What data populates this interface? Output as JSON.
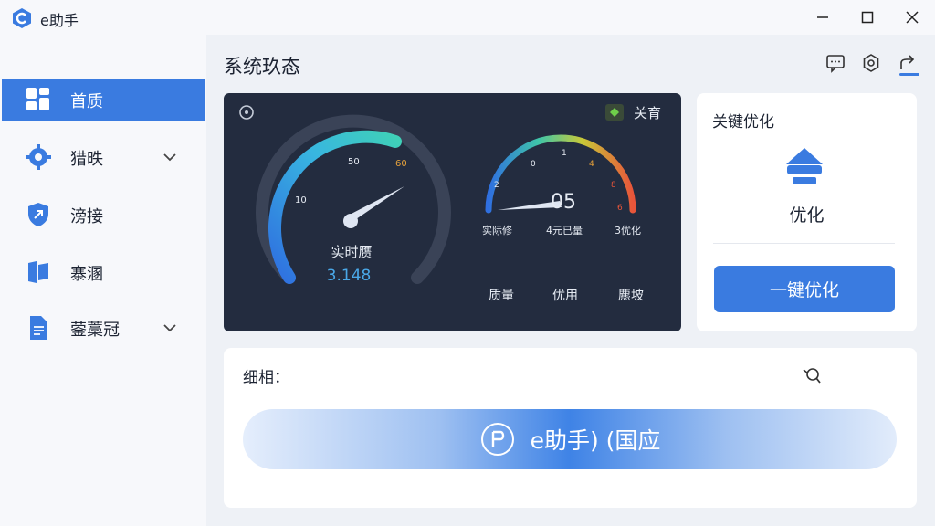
{
  "window": {
    "title": "e助手"
  },
  "sidebar": {
    "items": [
      {
        "label": "首质",
        "icon": "dashboard-icon",
        "active": true
      },
      {
        "label": "猎昳",
        "icon": "gear-icon",
        "expandable": true
      },
      {
        "label": "滂接",
        "icon": "shield-icon"
      },
      {
        "label": "寨溷",
        "icon": "flag-icon"
      },
      {
        "label": "蓥藁冠",
        "icon": "document-icon",
        "expandable": true
      }
    ]
  },
  "header": {
    "title": "系统玖态"
  },
  "toolbar": {
    "icons": [
      "message-icon",
      "settings-icon",
      "export-icon"
    ]
  },
  "gauges": {
    "main": {
      "ticks": [
        "10",
        "50",
        "60"
      ],
      "label": "实时赝",
      "value": "3.148"
    },
    "secondary": {
      "ticks": [
        "0",
        "1",
        "2",
        "4",
        "8",
        "6"
      ],
      "value": "05",
      "sub_labels": [
        "实际修",
        "4元已量",
        "3优化"
      ]
    },
    "toggle_label": "关育",
    "bottom_labels": [
      "质量",
      "优用",
      "麃坡"
    ]
  },
  "optimize": {
    "title": "关键优化",
    "label": "优化",
    "button": "一键优化"
  },
  "bottom": {
    "label": "细相：",
    "pill_text": "e助手) (国应"
  },
  "colors": {
    "accent": "#3a7be0",
    "card_dark": "#232c3f",
    "background": "#eef1f6"
  }
}
